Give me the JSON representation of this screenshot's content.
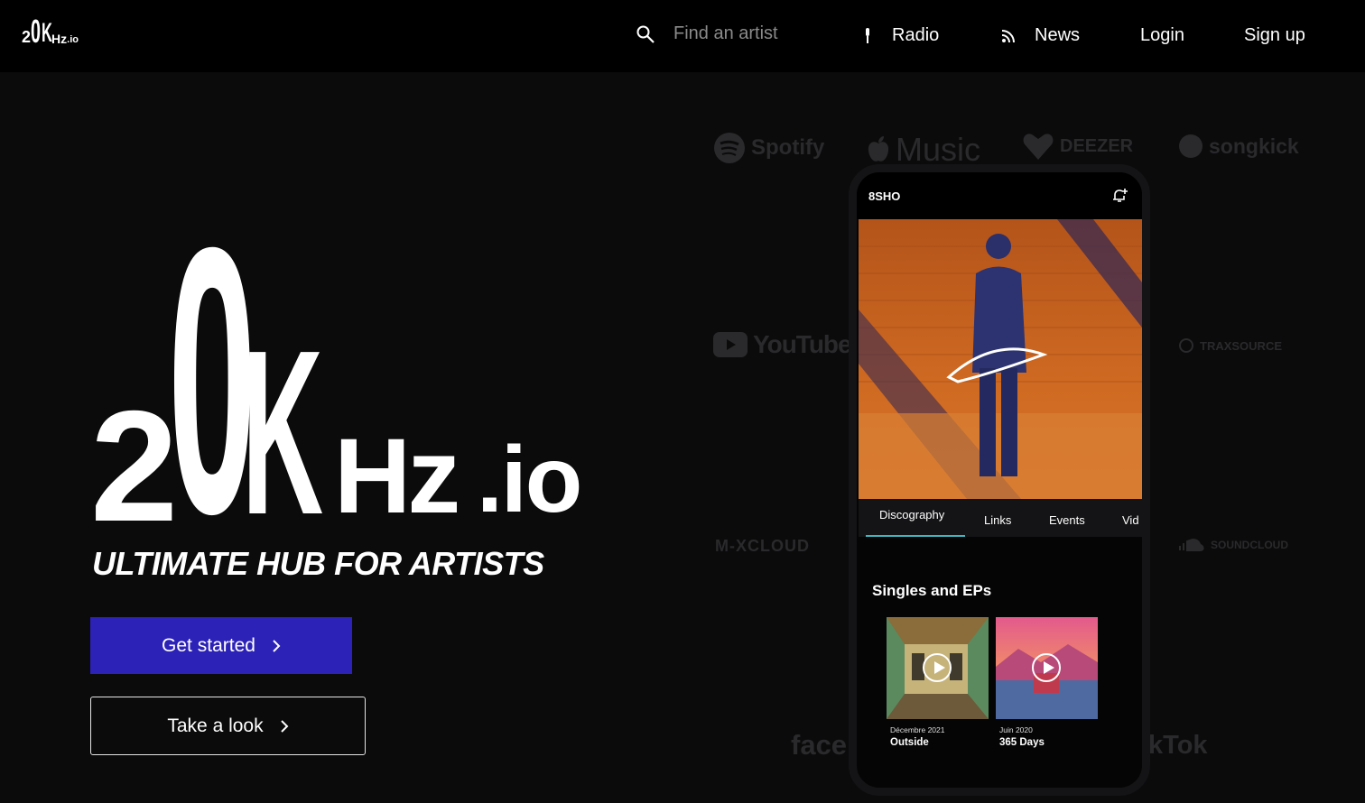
{
  "nav": {
    "logo": {
      "two": "2",
      "zero": "0",
      "k": "K",
      "hz": "Hz",
      "io": ".io"
    },
    "search_placeholder": "Find an artist",
    "radio_label": "Radio",
    "news_label": "News",
    "login_label": "Login",
    "signup_label": "Sign up"
  },
  "hero": {
    "logo": {
      "two": "2",
      "zero": "0",
      "k": "K",
      "hz": "Hz",
      "io": ".io"
    },
    "tagline": "ULTIMATE HUB FOR ARTISTS",
    "primary_button": "Get started",
    "secondary_button": "Take a look"
  },
  "services": {
    "spotify": "Spotify",
    "apple_music": "Music",
    "deezer": "DEEZER",
    "songkick": "songkick",
    "youtube": "YouTube",
    "traxsource": "TRAXSOURCE",
    "mixcloud": "M-XCLOUD",
    "soundcloud": "SOUNDCLOUD",
    "facebook": "faceb",
    "tiktok": "kTok"
  },
  "phone": {
    "artist_name": "8SHO",
    "cover_signature": "8SHO",
    "tabs": [
      "Discography",
      "Links",
      "Events",
      "Vid"
    ],
    "active_tab": "Discography",
    "section_title": "Singles and EPs",
    "releases": [
      {
        "date": "Décembre 2021",
        "title": "Outside"
      },
      {
        "date": "Juin 2020",
        "title": "365 Days"
      }
    ]
  },
  "colors": {
    "background": "#0b0b0c",
    "topbar": "#000000",
    "primary_button": "#2c22b8",
    "tab_indicator": "#3fb7c2",
    "cover_orange": "#c9621d",
    "faded_logo": "#2a2a2c"
  },
  "icons": {
    "search": "search-icon",
    "radio": "microphone-icon",
    "news": "rss-icon",
    "notify": "bell-plus-icon",
    "chevron": "chevron-right-icon",
    "play": "play-circle-icon"
  }
}
